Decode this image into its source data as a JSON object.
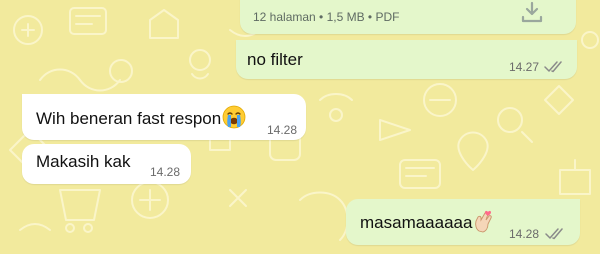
{
  "colors": {
    "wallpaper": "#f2ea9d",
    "outgoing_bubble": "#e4f7cb",
    "incoming_bubble": "#ffffff",
    "read_ticks": "#8a8a8a"
  },
  "messages": [
    {
      "direction": "outgoing",
      "type": "document",
      "meta": "12 halaman • 1,5 MB • PDF",
      "icon": "download-icon"
    },
    {
      "direction": "outgoing",
      "text": "no filter",
      "time": "14.27",
      "status": "read",
      "status_icon": "double-check-icon"
    },
    {
      "direction": "incoming",
      "text": "Wih beneran fast respon",
      "emoji": "loudly-crying-face-icon",
      "time": "14.28"
    },
    {
      "direction": "incoming",
      "text": "Makasih kak",
      "time": "14.28"
    },
    {
      "direction": "outgoing",
      "text": "masamaaaaaa",
      "emoji": "finger-heart-icon",
      "time": "14.28",
      "status": "read",
      "status_icon": "double-check-icon"
    }
  ]
}
